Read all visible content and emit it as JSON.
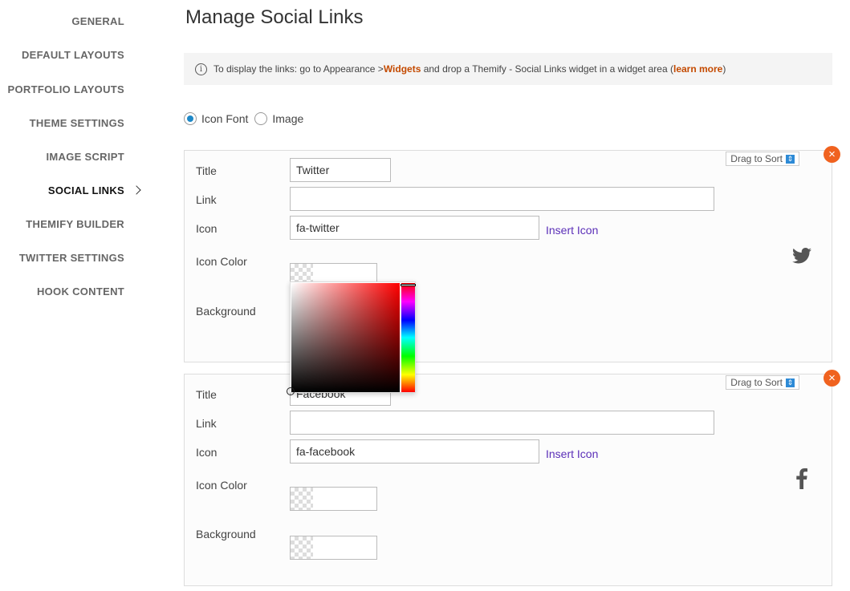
{
  "sidebar": {
    "items": [
      {
        "label": "GENERAL",
        "active": false
      },
      {
        "label": "DEFAULT LAYOUTS",
        "active": false
      },
      {
        "label": "PORTFOLIO LAYOUTS",
        "active": false
      },
      {
        "label": "THEME SETTINGS",
        "active": false
      },
      {
        "label": "IMAGE SCRIPT",
        "active": false
      },
      {
        "label": "SOCIAL LINKS",
        "active": true
      },
      {
        "label": "THEMIFY BUILDER",
        "active": false
      },
      {
        "label": "TWITTER SETTINGS",
        "active": false
      },
      {
        "label": "HOOK CONTENT",
        "active": false
      }
    ]
  },
  "page": {
    "title": "Manage Social Links"
  },
  "notice": {
    "icon": "info-icon",
    "text_before": "To display the links: go to Appearance > ",
    "widgets_link": "Widgets",
    "text_middle": " and drop a Themify - Social Links widget in a widget area (",
    "learn_more_link": "learn more",
    "text_after": ")"
  },
  "icon_type": {
    "options": [
      "Icon Font",
      "Image"
    ],
    "selected": "Icon Font"
  },
  "labels": {
    "title": "Title",
    "link": "Link",
    "icon": "Icon",
    "icon_color": "Icon Color",
    "background": "Background",
    "insert_icon": "Insert Icon",
    "drag_to_sort": "Drag to Sort",
    "remove": "×"
  },
  "links": [
    {
      "title": "Twitter",
      "link": "",
      "icon": "fa-twitter",
      "icon_color": "",
      "background": "",
      "preview_icon": "twitter-icon"
    },
    {
      "title": "Facebook",
      "link": "",
      "icon": "fa-facebook",
      "icon_color": "",
      "background": "",
      "preview_icon": "facebook-icon"
    }
  ],
  "colors": {
    "accent_link": "#c44a00",
    "insert_icon_link": "#5b2fb8",
    "remove_button": "#f0621f",
    "radio_selected": "#1e88c7"
  }
}
